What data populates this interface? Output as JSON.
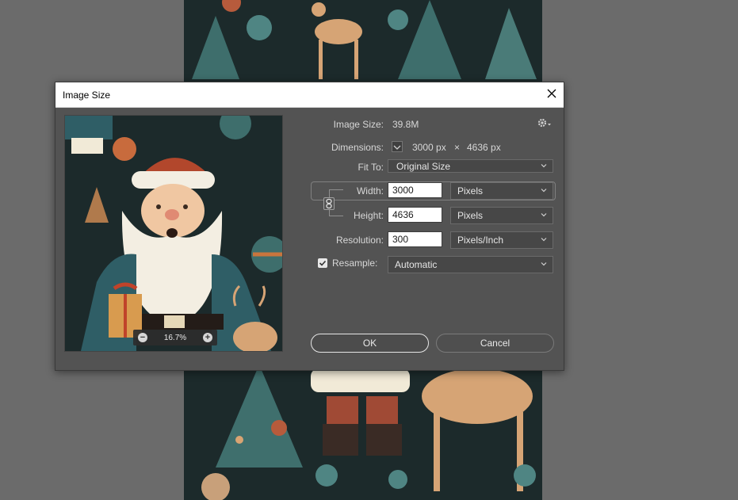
{
  "dialog": {
    "title": "Image Size",
    "close_icon": "close-icon"
  },
  "preview": {
    "zoom": "16.7%",
    "zoom_out_icon": "zoom-out-icon",
    "zoom_in_icon": "zoom-in-icon"
  },
  "info": {
    "image_size_label": "Image Size:",
    "image_size_value": "39.8M",
    "dimensions_label": "Dimensions:",
    "dim_width": "3000 px",
    "dim_times": "×",
    "dim_height": "4636 px",
    "settings_icon": "gear-icon"
  },
  "fit_to": {
    "label": "Fit To:",
    "value": "Original Size"
  },
  "width": {
    "label": "Width:",
    "value": "3000",
    "unit": "Pixels"
  },
  "height": {
    "label": "Height:",
    "value": "4636",
    "unit": "Pixels"
  },
  "resolution": {
    "label": "Resolution:",
    "value": "300",
    "unit": "Pixels/Inch"
  },
  "resample": {
    "label": "Resample:",
    "checked": true,
    "value": "Automatic"
  },
  "buttons": {
    "ok": "OK",
    "cancel": "Cancel"
  },
  "colors": {
    "workspace": "#6b6b6b",
    "dialog_bg": "#535353",
    "artwork_bg": "#1c2a2b"
  }
}
